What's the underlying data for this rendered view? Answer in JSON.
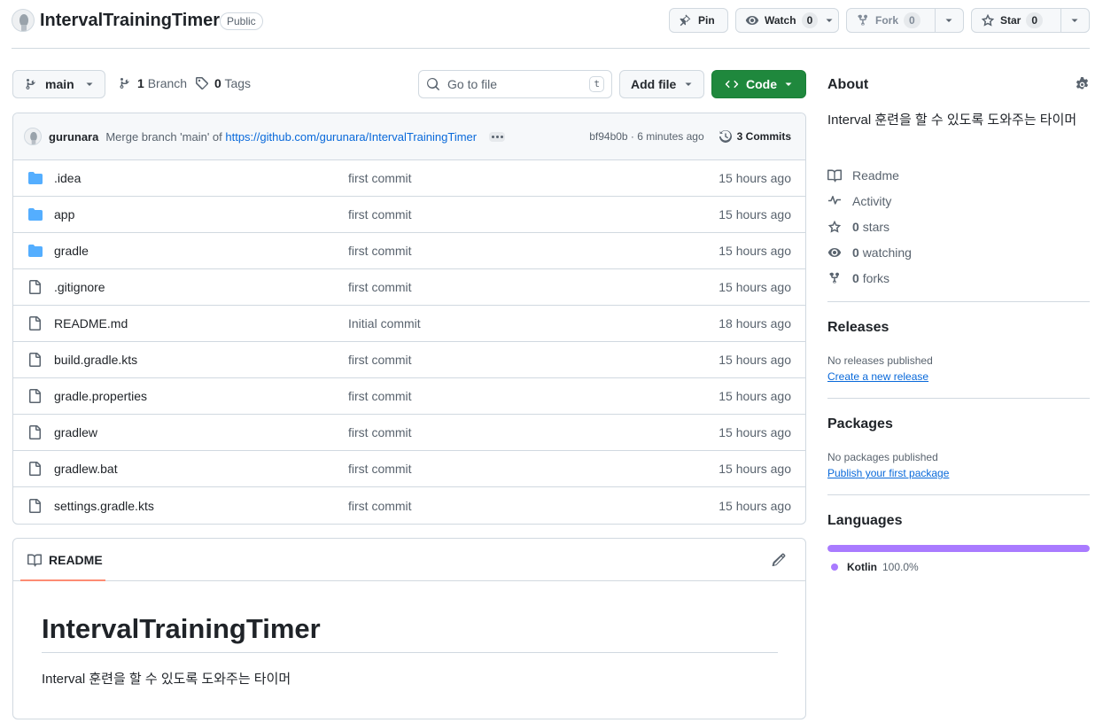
{
  "header": {
    "repo_name": "IntervalTrainingTimer",
    "visibility": "Public",
    "pin_label": "Pin",
    "watch_label": "Watch",
    "watch_count": "0",
    "fork_label": "Fork",
    "fork_count": "0",
    "star_label": "Star",
    "star_count": "0"
  },
  "toolbar": {
    "branch": "main",
    "branch_count": "1",
    "branch_label": "Branch",
    "tag_count": "0",
    "tag_label": "Tags",
    "search_placeholder": "Go to file",
    "search_shortcut": "t",
    "add_file_label": "Add file",
    "code_label": "Code"
  },
  "commit": {
    "author": "gurunara",
    "message_prefix": "Merge branch 'main' of ",
    "message_link": "https://github.com/gurunara/IntervalTrainingTimer",
    "sha_time": "bf94b0b · 6 minutes ago",
    "commits_label": "3 Commits"
  },
  "files": [
    {
      "name": ".idea",
      "type": "folder",
      "message": "first commit",
      "time": "15 hours ago"
    },
    {
      "name": "app",
      "type": "folder",
      "message": "first commit",
      "time": "15 hours ago"
    },
    {
      "name": "gradle",
      "type": "folder",
      "message": "first commit",
      "time": "15 hours ago"
    },
    {
      "name": ".gitignore",
      "type": "file",
      "message": "first commit",
      "time": "15 hours ago"
    },
    {
      "name": "README.md",
      "type": "file",
      "message": "Initial commit",
      "time": "18 hours ago"
    },
    {
      "name": "build.gradle.kts",
      "type": "file",
      "message": "first commit",
      "time": "15 hours ago"
    },
    {
      "name": "gradle.properties",
      "type": "file",
      "message": "first commit",
      "time": "15 hours ago"
    },
    {
      "name": "gradlew",
      "type": "file",
      "message": "first commit",
      "time": "15 hours ago"
    },
    {
      "name": "gradlew.bat",
      "type": "file",
      "message": "first commit",
      "time": "15 hours ago"
    },
    {
      "name": "settings.gradle.kts",
      "type": "file",
      "message": "first commit",
      "time": "15 hours ago"
    }
  ],
  "readme": {
    "tab_label": "README",
    "title": "IntervalTrainingTimer",
    "body": "Interval 훈련을 할 수 있도록 도와주는 타이머"
  },
  "about": {
    "heading": "About",
    "description": "Interval 훈련을 할 수 있도록 도와주는 타이머",
    "readme_label": "Readme",
    "activity_label": "Activity",
    "stars_count": "0",
    "stars_label": "stars",
    "watching_count": "0",
    "watching_label": "watching",
    "forks_count": "0",
    "forks_label": "forks"
  },
  "releases": {
    "heading": "Releases",
    "empty_text": "No releases published",
    "link": "Create a new release"
  },
  "packages": {
    "heading": "Packages",
    "empty_text": "No packages published",
    "link": "Publish your first package"
  },
  "languages": {
    "heading": "Languages",
    "items": [
      {
        "name": "Kotlin",
        "percent": "100.0%",
        "fraction": 1.0,
        "color": "#a97bff"
      }
    ]
  }
}
